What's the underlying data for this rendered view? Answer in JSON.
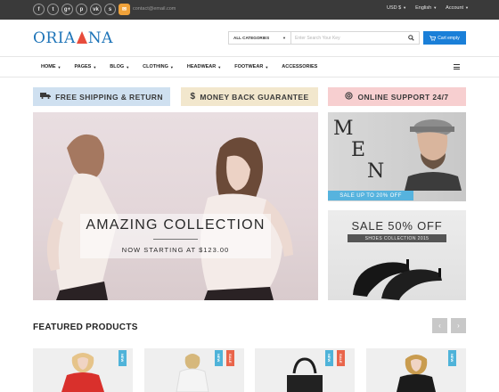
{
  "topbar": {
    "social": [
      {
        "icon": "facebook-icon",
        "glyph": "f"
      },
      {
        "icon": "twitter-icon",
        "glyph": "t"
      },
      {
        "icon": "google-plus-icon",
        "glyph": "g+"
      },
      {
        "icon": "pinterest-icon",
        "glyph": "p"
      },
      {
        "icon": "vk-icon",
        "glyph": "vk"
      },
      {
        "icon": "skype-icon",
        "glyph": "s"
      },
      {
        "icon": "mail-icon",
        "glyph": "✉"
      }
    ],
    "email": "contact@email.com",
    "currency": "USD $",
    "language": "English",
    "account": "Account"
  },
  "header": {
    "logo_left": "ORIA",
    "logo_right": "NA",
    "search_category": "ALL CATEGORIES",
    "search_placeholder": "Enter Search Your Key",
    "cart_label": "Cart empty"
  },
  "nav": {
    "items": [
      {
        "label": "Home",
        "dropdown": true
      },
      {
        "label": "Pages",
        "dropdown": true
      },
      {
        "label": "Blog",
        "dropdown": true
      },
      {
        "label": "Clothing",
        "dropdown": true
      },
      {
        "label": "Headwear",
        "dropdown": true
      },
      {
        "label": "Footwear",
        "dropdown": true
      },
      {
        "label": "Accessories",
        "dropdown": false
      }
    ]
  },
  "promos": [
    {
      "label": "FREE SHIPPING & RETURN",
      "icon": "truck-icon",
      "color": "#cfe0f0"
    },
    {
      "label": "MONEY BACK GUARANTEE",
      "icon": "dollar-icon",
      "color": "#f2e7cd"
    },
    {
      "label": "ONLINE SUPPORT 24/7",
      "icon": "support-icon",
      "color": "#f7cfd0"
    }
  ],
  "banner": {
    "headline": "AMAZING COLLECTION",
    "subline": "NOW STARTING AT $123.00"
  },
  "side_banners": {
    "men_letters": [
      "M",
      "E",
      "N"
    ],
    "men_tag": "SALE UP TO 20% OFF",
    "sale_title": "SALE 50% OFF",
    "sale_sub": "SHOES COLLECTION 2015"
  },
  "featured": {
    "title": "FEATURED PRODUCTS",
    "prev": "‹",
    "next": "›",
    "products": [
      {
        "badge": "NEW",
        "type": "new"
      },
      {
        "badge": "SALE",
        "type": "sale",
        "badge2": "NEW"
      },
      {
        "badge": "SALE",
        "type": "sale",
        "badge2": "NEW"
      },
      {
        "badge": "NEW",
        "type": "new"
      }
    ]
  },
  "colors": {
    "brand": "#1e74b8",
    "cart": "#1a7fd8",
    "topbar": "#3a3a3a",
    "new_badge": "#4fb3d9",
    "sale_badge": "#e9654b"
  }
}
